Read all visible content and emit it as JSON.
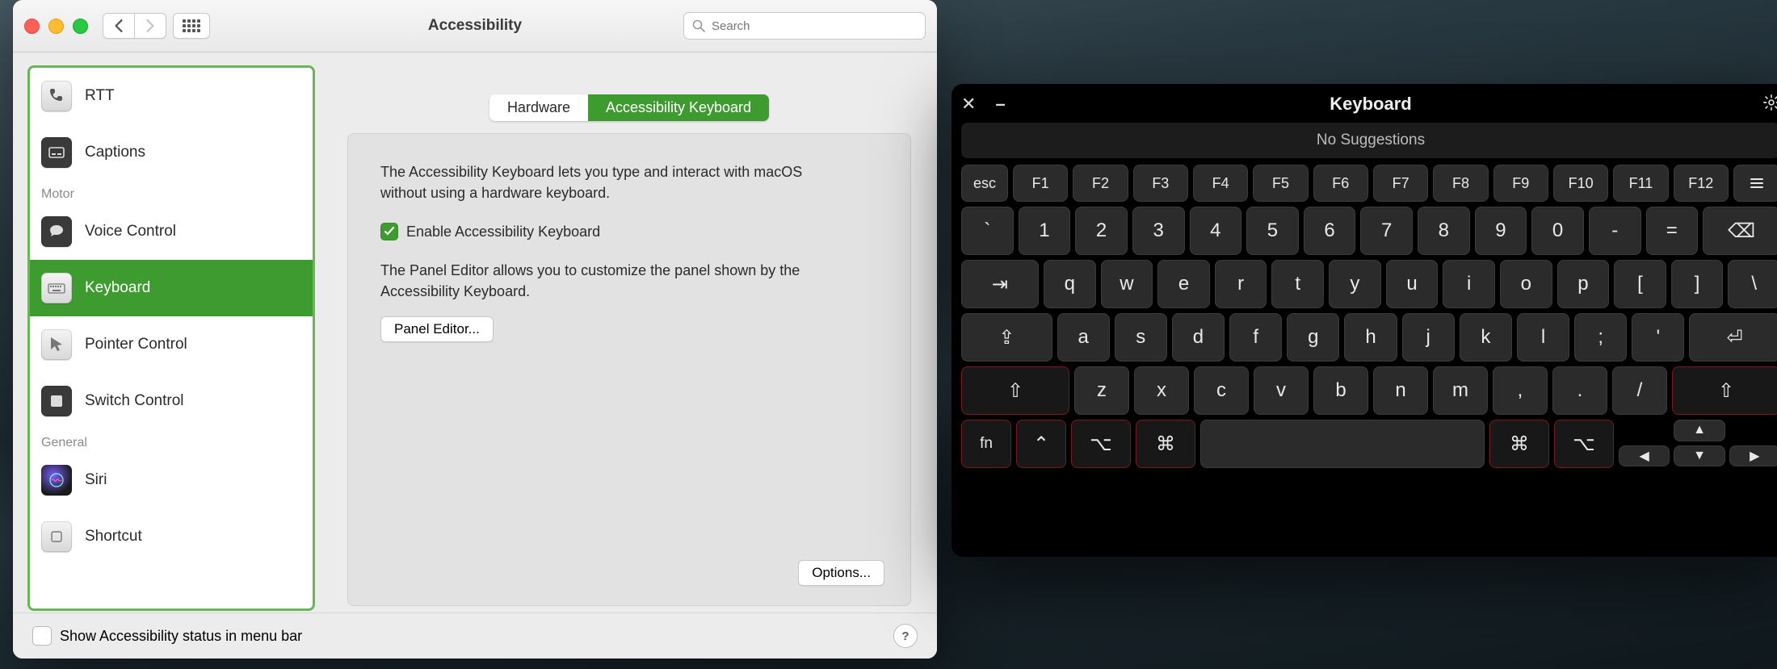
{
  "prefs": {
    "title": "Accessibility",
    "search_placeholder": "Search",
    "sidebar": {
      "groups": [
        {
          "items": [
            {
              "label": "RTT",
              "icon": "phone"
            },
            {
              "label": "Captions",
              "icon": "captions"
            }
          ]
        },
        {
          "header": "Motor",
          "items": [
            {
              "label": "Voice Control",
              "icon": "voice"
            },
            {
              "label": "Keyboard",
              "icon": "keyboard",
              "selected": true
            },
            {
              "label": "Pointer Control",
              "icon": "pointer"
            },
            {
              "label": "Switch Control",
              "icon": "switch"
            }
          ]
        },
        {
          "header": "General",
          "items": [
            {
              "label": "Siri",
              "icon": "siri"
            },
            {
              "label": "Shortcut",
              "icon": "shortcut"
            }
          ]
        }
      ]
    },
    "tabs": {
      "hardware": "Hardware",
      "accessibility_keyboard": "Accessibility Keyboard",
      "active": "accessibility_keyboard"
    },
    "content": {
      "intro": "The Accessibility Keyboard lets you type and interact with macOS without using a hardware keyboard.",
      "enable_label": "Enable Accessibility Keyboard",
      "enable_checked": true,
      "panel_editor_desc": "The Panel Editor allows you to customize the panel shown by the Accessibility Keyboard.",
      "panel_editor_btn": "Panel Editor...",
      "options_btn": "Options..."
    },
    "footer": {
      "status_label": "Show Accessibility status in menu bar",
      "status_checked": false
    }
  },
  "akbd": {
    "title": "Keyboard",
    "suggestions": "No Suggestions",
    "rows": {
      "fn": [
        "esc",
        "F1",
        "F2",
        "F3",
        "F4",
        "F5",
        "F6",
        "F7",
        "F8",
        "F9",
        "F10",
        "F11",
        "F12",
        "≡"
      ],
      "num": [
        "`",
        "1",
        "2",
        "3",
        "4",
        "5",
        "6",
        "7",
        "8",
        "9",
        "0",
        "-",
        "=",
        "⌫"
      ],
      "qw": [
        "⇥",
        "q",
        "w",
        "e",
        "r",
        "t",
        "y",
        "u",
        "i",
        "o",
        "p",
        "[",
        "]",
        "\\"
      ],
      "as": [
        "⇪",
        "a",
        "s",
        "d",
        "f",
        "g",
        "h",
        "j",
        "k",
        "l",
        ";",
        "'",
        "⏎"
      ],
      "zx": [
        "⇧",
        "z",
        "x",
        "c",
        "v",
        "b",
        "n",
        "m",
        ",",
        ".",
        "/",
        "⇧"
      ],
      "mod": [
        "fn",
        "⌃",
        "⌥",
        "⌘",
        " ",
        "⌘",
        "⌥"
      ],
      "arrows": {
        "up": "▲",
        "left": "◀",
        "down": "▼",
        "right": "▶"
      }
    }
  }
}
